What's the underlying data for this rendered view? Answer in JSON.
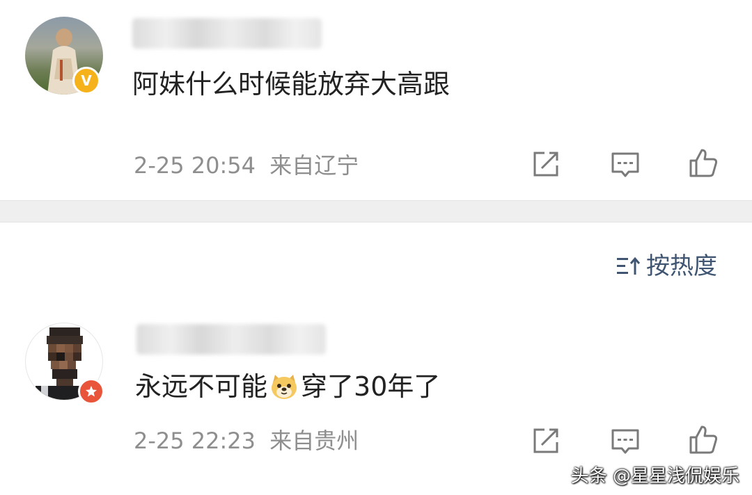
{
  "comments": [
    {
      "text": "阿妹什么时候能放弃大高跟",
      "time": "2-25 20:54",
      "location": "来自辽宁",
      "avatar_icon": "avatar-photo",
      "badge_icon": "verified-v-icon",
      "badge_text": "V",
      "badge_color": "#f5b21a"
    },
    {
      "text_before": "永远不可能",
      "emoji_icon": "doge-emoji-icon",
      "text_after": "穿了30年了",
      "time": "2-25 22:23",
      "location": "来自贵州",
      "avatar_icon": "avatar-pixelated",
      "badge_icon": "level-badge-icon",
      "badge_color": "#e8553b"
    }
  ],
  "actions": {
    "share_icon": "share-icon",
    "comment_icon": "comment-icon",
    "like_icon": "thumbs-up-icon"
  },
  "sort": {
    "icon": "sort-icon",
    "label": "按热度"
  },
  "watermark": "头条 @星星浅侃娱乐",
  "colors": {
    "text": "#222222",
    "meta": "#8e8e8e",
    "icon": "#7a7a7a",
    "divider": "#efefef",
    "sort_accent": "#3f5572"
  }
}
